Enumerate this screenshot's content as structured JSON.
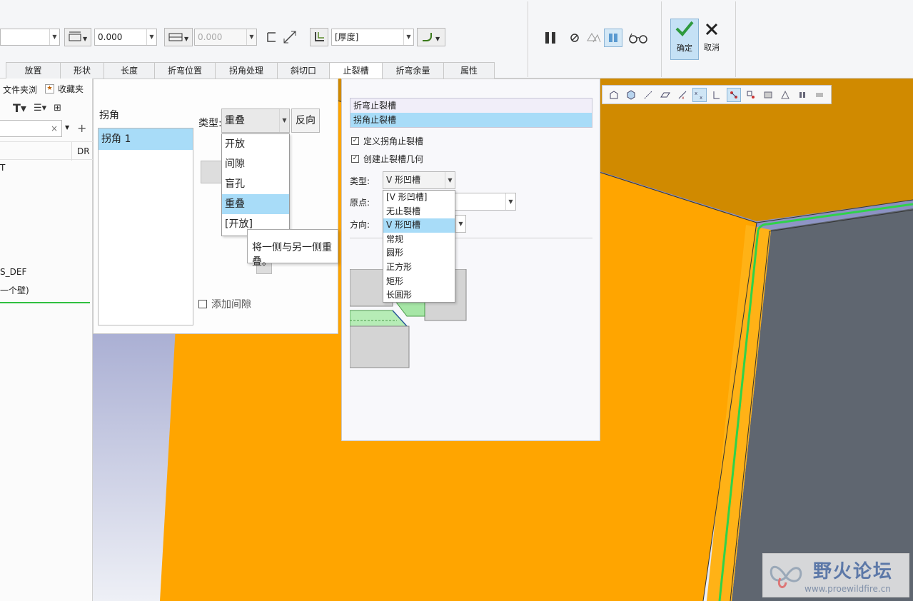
{
  "ribbon": {
    "value_1": "0.000",
    "value_2": "0.000",
    "thickness_combo": "[厚度]",
    "tabs": [
      "放置",
      "形状",
      "长度",
      "折弯位置",
      "拐角处理",
      "斜切口",
      "止裂槽",
      "折弯余量",
      "属性"
    ],
    "active_tab": 6,
    "ok_label": "确定",
    "cancel_label": "取消"
  },
  "tree": {
    "folder_tab": "文件夹浏",
    "favorites_tab": "收藏夹",
    "column": "DR",
    "items": [
      "T",
      "S_DEF",
      "一个壁)"
    ]
  },
  "corner_panel": {
    "corners_label": "拐角",
    "corners": [
      "拐角 1"
    ],
    "type_label": "类型:",
    "type_value": "重叠",
    "flip_button": "反向",
    "type_options": [
      "开放",
      "间隙",
      "盲孔",
      "重叠",
      "[开放]"
    ],
    "type_selected": 3,
    "tooltip": "将一侧与另一侧重叠。",
    "add_gap_label": "添加间隙"
  },
  "relief_panel": {
    "relief_kinds": [
      "折弯止裂槽",
      "拐角止裂槽"
    ],
    "relief_selected": 1,
    "define_corner_relief": "定义拐角止裂槽",
    "create_relief_geometry": "创建止裂槽几何",
    "type_label": "类型:",
    "type_value": "V 形凹槽",
    "origin_label": "原点:",
    "direction_label": "方向:",
    "type_options": [
      "[V 形凹槽]",
      "无止裂槽",
      "V 形凹槽",
      "常规",
      "圆形",
      "正方形",
      "矩形",
      "长圆形"
    ],
    "type_selected": 2
  },
  "watermark": {
    "title": "野火论坛",
    "url": "www.proewildfire.cn"
  },
  "colors": {
    "model_orange": "#ffa500",
    "model_top_orange": "#d08a00",
    "model_gray": "#5f6670",
    "edge_green": "#2fd24a",
    "selection_blue": "#a8dcf8",
    "background_blue": "#6a72b3"
  }
}
